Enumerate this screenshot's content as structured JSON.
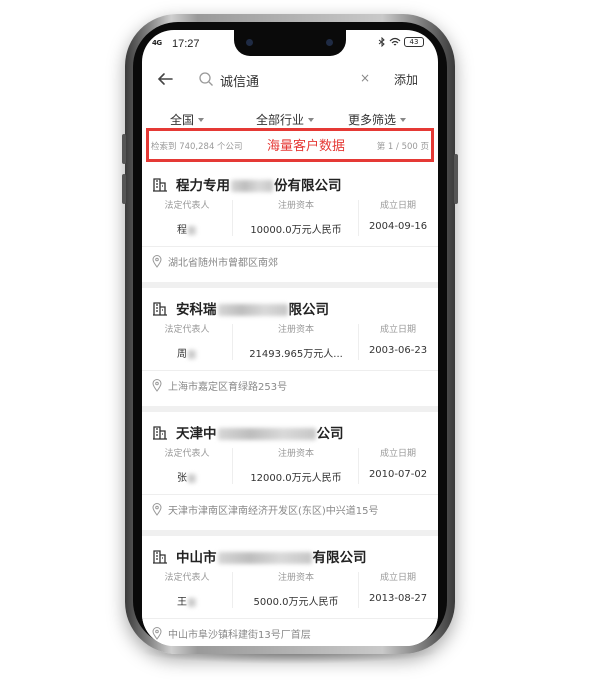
{
  "status": {
    "network": "4G",
    "time": "17:27",
    "battery": "43"
  },
  "search": {
    "query": "诚信通",
    "clear": "×",
    "add_label": "添加"
  },
  "filters": [
    {
      "label": "全国"
    },
    {
      "label": "全部行业"
    },
    {
      "label": "更多筛选"
    }
  ],
  "summary": {
    "count_text": "检索到 740,284 个公司",
    "banner": "海量客户数据",
    "page_text": "第 1 / 500 页"
  },
  "field_labels": {
    "legal_rep": "法定代表人",
    "capital": "注册资本",
    "founded": "成立日期"
  },
  "companies": [
    {
      "name_start": "程力专用",
      "name_end": "份有限公司",
      "rep": "程",
      "capital": "10000.0万元人民币",
      "date": "2004-09-16",
      "address": "湖北省随州市曾都区南郊"
    },
    {
      "name_start": "安科瑞",
      "name_end": "限公司",
      "rep": "周",
      "capital": "21493.965万元人...",
      "date": "2003-06-23",
      "address": "上海市嘉定区育绿路253号"
    },
    {
      "name_start": "天津中",
      "name_end": "公司",
      "rep": "张",
      "capital": "12000.0万元人民币",
      "date": "2010-07-02",
      "address": "天津市津南区津南经济开发区(东区)中兴道15号"
    },
    {
      "name_start": "中山市",
      "name_end": "有限公司",
      "rep": "王",
      "capital": "5000.0万元人民币",
      "date": "2013-08-27",
      "address": "中山市阜沙镇科建街13号厂首层"
    }
  ]
}
